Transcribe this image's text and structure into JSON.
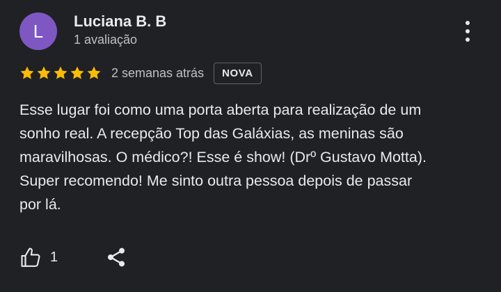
{
  "reviewer": {
    "avatar_letter": "L",
    "avatar_color": "#7e57c2",
    "name": "Luciana B. B",
    "review_count": "1 avaliação"
  },
  "menu_icon": "more-vertical-icon",
  "rating": {
    "stars": 5,
    "max_stars": 5,
    "star_color": "#fbbc04",
    "date": "2 semanas atrás",
    "badge": "NOVA"
  },
  "review": {
    "lines": [
      "Esse lugar foi como uma porta aberta para realização de um",
      "sonho real. A recepção Top das Galáxias, as meninas são",
      "maravilhosas. O médico?! Esse é show! (Drº Gustavo Motta).",
      "Super recomendo! Me sinto outra pessoa depois de passar",
      "por lá."
    ]
  },
  "actions": {
    "like_icon": "thumbs-up-icon",
    "like_count": "1",
    "share_icon": "share-icon"
  }
}
